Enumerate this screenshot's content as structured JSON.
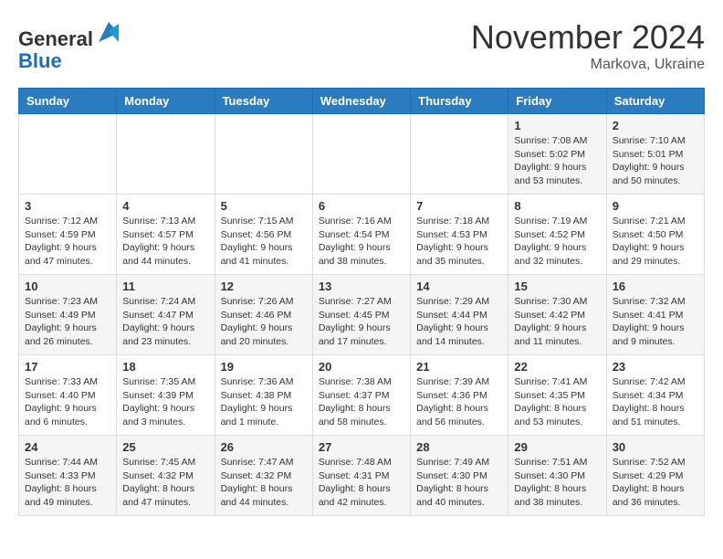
{
  "logo": {
    "general": "General",
    "blue": "Blue"
  },
  "header": {
    "month": "November 2024",
    "location": "Markova, Ukraine"
  },
  "weekdays": [
    "Sunday",
    "Monday",
    "Tuesday",
    "Wednesday",
    "Thursday",
    "Friday",
    "Saturday"
  ],
  "weeks": [
    [
      {
        "day": "",
        "info": ""
      },
      {
        "day": "",
        "info": ""
      },
      {
        "day": "",
        "info": ""
      },
      {
        "day": "",
        "info": ""
      },
      {
        "day": "",
        "info": ""
      },
      {
        "day": "1",
        "info": "Sunrise: 7:08 AM\nSunset: 5:02 PM\nDaylight: 9 hours\nand 53 minutes."
      },
      {
        "day": "2",
        "info": "Sunrise: 7:10 AM\nSunset: 5:01 PM\nDaylight: 9 hours\nand 50 minutes."
      }
    ],
    [
      {
        "day": "3",
        "info": "Sunrise: 7:12 AM\nSunset: 4:59 PM\nDaylight: 9 hours\nand 47 minutes."
      },
      {
        "day": "4",
        "info": "Sunrise: 7:13 AM\nSunset: 4:57 PM\nDaylight: 9 hours\nand 44 minutes."
      },
      {
        "day": "5",
        "info": "Sunrise: 7:15 AM\nSunset: 4:56 PM\nDaylight: 9 hours\nand 41 minutes."
      },
      {
        "day": "6",
        "info": "Sunrise: 7:16 AM\nSunset: 4:54 PM\nDaylight: 9 hours\nand 38 minutes."
      },
      {
        "day": "7",
        "info": "Sunrise: 7:18 AM\nSunset: 4:53 PM\nDaylight: 9 hours\nand 35 minutes."
      },
      {
        "day": "8",
        "info": "Sunrise: 7:19 AM\nSunset: 4:52 PM\nDaylight: 9 hours\nand 32 minutes."
      },
      {
        "day": "9",
        "info": "Sunrise: 7:21 AM\nSunset: 4:50 PM\nDaylight: 9 hours\nand 29 minutes."
      }
    ],
    [
      {
        "day": "10",
        "info": "Sunrise: 7:23 AM\nSunset: 4:49 PM\nDaylight: 9 hours\nand 26 minutes."
      },
      {
        "day": "11",
        "info": "Sunrise: 7:24 AM\nSunset: 4:47 PM\nDaylight: 9 hours\nand 23 minutes."
      },
      {
        "day": "12",
        "info": "Sunrise: 7:26 AM\nSunset: 4:46 PM\nDaylight: 9 hours\nand 20 minutes."
      },
      {
        "day": "13",
        "info": "Sunrise: 7:27 AM\nSunset: 4:45 PM\nDaylight: 9 hours\nand 17 minutes."
      },
      {
        "day": "14",
        "info": "Sunrise: 7:29 AM\nSunset: 4:44 PM\nDaylight: 9 hours\nand 14 minutes."
      },
      {
        "day": "15",
        "info": "Sunrise: 7:30 AM\nSunset: 4:42 PM\nDaylight: 9 hours\nand 11 minutes."
      },
      {
        "day": "16",
        "info": "Sunrise: 7:32 AM\nSunset: 4:41 PM\nDaylight: 9 hours\nand 9 minutes."
      }
    ],
    [
      {
        "day": "17",
        "info": "Sunrise: 7:33 AM\nSunset: 4:40 PM\nDaylight: 9 hours\nand 6 minutes."
      },
      {
        "day": "18",
        "info": "Sunrise: 7:35 AM\nSunset: 4:39 PM\nDaylight: 9 hours\nand 3 minutes."
      },
      {
        "day": "19",
        "info": "Sunrise: 7:36 AM\nSunset: 4:38 PM\nDaylight: 9 hours\nand 1 minute."
      },
      {
        "day": "20",
        "info": "Sunrise: 7:38 AM\nSunset: 4:37 PM\nDaylight: 8 hours\nand 58 minutes."
      },
      {
        "day": "21",
        "info": "Sunrise: 7:39 AM\nSunset: 4:36 PM\nDaylight: 8 hours\nand 56 minutes."
      },
      {
        "day": "22",
        "info": "Sunrise: 7:41 AM\nSunset: 4:35 PM\nDaylight: 8 hours\nand 53 minutes."
      },
      {
        "day": "23",
        "info": "Sunrise: 7:42 AM\nSunset: 4:34 PM\nDaylight: 8 hours\nand 51 minutes."
      }
    ],
    [
      {
        "day": "24",
        "info": "Sunrise: 7:44 AM\nSunset: 4:33 PM\nDaylight: 8 hours\nand 49 minutes."
      },
      {
        "day": "25",
        "info": "Sunrise: 7:45 AM\nSunset: 4:32 PM\nDaylight: 8 hours\nand 47 minutes."
      },
      {
        "day": "26",
        "info": "Sunrise: 7:47 AM\nSunset: 4:32 PM\nDaylight: 8 hours\nand 44 minutes."
      },
      {
        "day": "27",
        "info": "Sunrise: 7:48 AM\nSunset: 4:31 PM\nDaylight: 8 hours\nand 42 minutes."
      },
      {
        "day": "28",
        "info": "Sunrise: 7:49 AM\nSunset: 4:30 PM\nDaylight: 8 hours\nand 40 minutes."
      },
      {
        "day": "29",
        "info": "Sunrise: 7:51 AM\nSunset: 4:30 PM\nDaylight: 8 hours\nand 38 minutes."
      },
      {
        "day": "30",
        "info": "Sunrise: 7:52 AM\nSunset: 4:29 PM\nDaylight: 8 hours\nand 36 minutes."
      }
    ]
  ]
}
